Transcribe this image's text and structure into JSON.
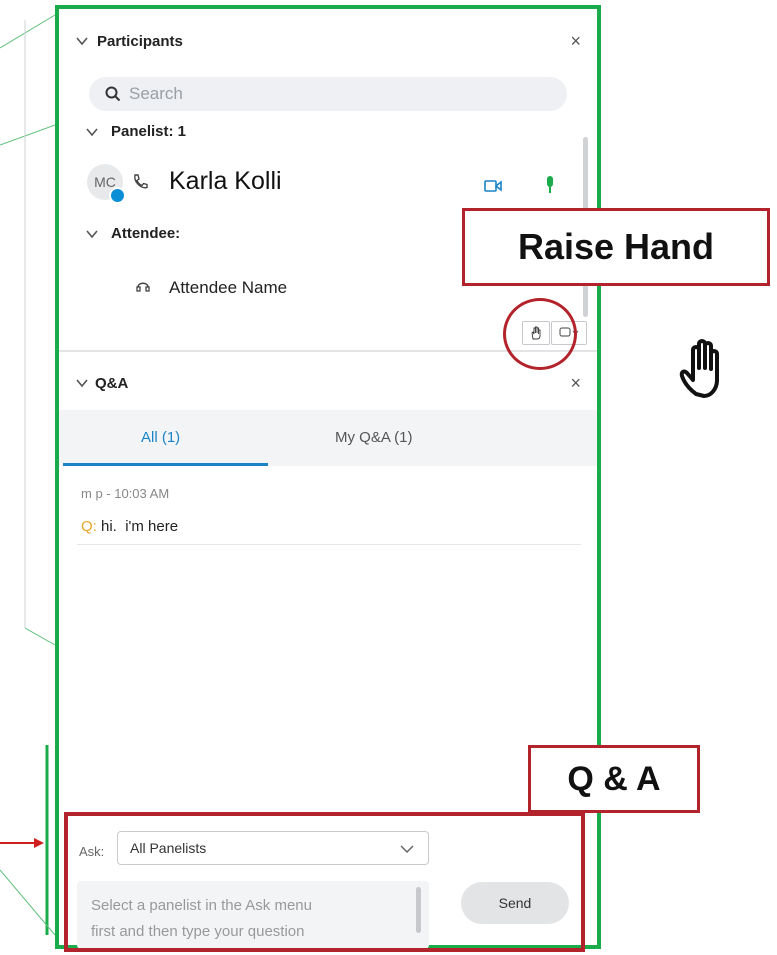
{
  "participants": {
    "title": "Participants",
    "close_label": "×",
    "search_placeholder": "Search",
    "panelist_group": "Panelist: 1",
    "panelist_avatar": "MC",
    "panelist_name": "Karla Kolli",
    "attendee_group": "Attendee:",
    "attendee_name": "Attendee Name"
  },
  "qa": {
    "title": "Q&A",
    "close_label": "×",
    "tabs": [
      {
        "label": "All (1)",
        "active": true
      },
      {
        "label": "My Q&A (1)",
        "active": false
      }
    ],
    "messages": [
      {
        "meta": "m p - 10:03 AM",
        "prefix": "Q:",
        "text": " hi.  i'm here"
      }
    ],
    "ask_label": "Ask:",
    "ask_selected": "All Panelists",
    "input_placeholder_line1": "Select a panelist in the Ask menu",
    "input_placeholder_line2": "first and then type your question",
    "send_label": "Send"
  },
  "callouts": {
    "raise_hand": "Raise Hand",
    "qa": "Q & A"
  },
  "colors": {
    "panel_border": "#1aab4a",
    "callout_red": "#b3232b",
    "accent_blue": "#1a84c7",
    "mic_green": "#1aab4a",
    "question_prefix": "#e7a52a"
  },
  "icons": [
    "chevron-down-icon",
    "search-icon",
    "close-icon",
    "phone-icon",
    "video-icon",
    "mic-icon",
    "headset-icon",
    "raise-hand-icon",
    "feedback-icon",
    "arrow-icon"
  ]
}
